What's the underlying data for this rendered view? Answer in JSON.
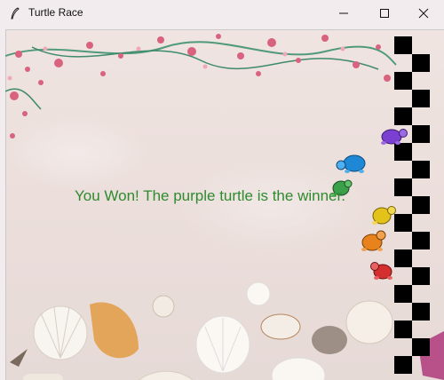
{
  "window": {
    "title": "Turtle Race",
    "minimize_icon": "minimize-icon",
    "maximize_icon": "maximize-icon",
    "close_icon": "close-icon"
  },
  "game": {
    "message": "You Won! The purple turtle is the winner.",
    "message_color": "#2e8b2e",
    "finish_line_colors": [
      "#000000",
      "#f3ecee"
    ],
    "turtles": [
      {
        "color": "purple",
        "hex": "#7b3fd1"
      },
      {
        "color": "blue",
        "hex": "#1e88d6"
      },
      {
        "color": "green",
        "hex": "#3aa04a"
      },
      {
        "color": "yellow",
        "hex": "#e3c21a"
      },
      {
        "color": "orange",
        "hex": "#e8821c"
      },
      {
        "color": "red",
        "hex": "#d32f2f"
      }
    ]
  }
}
